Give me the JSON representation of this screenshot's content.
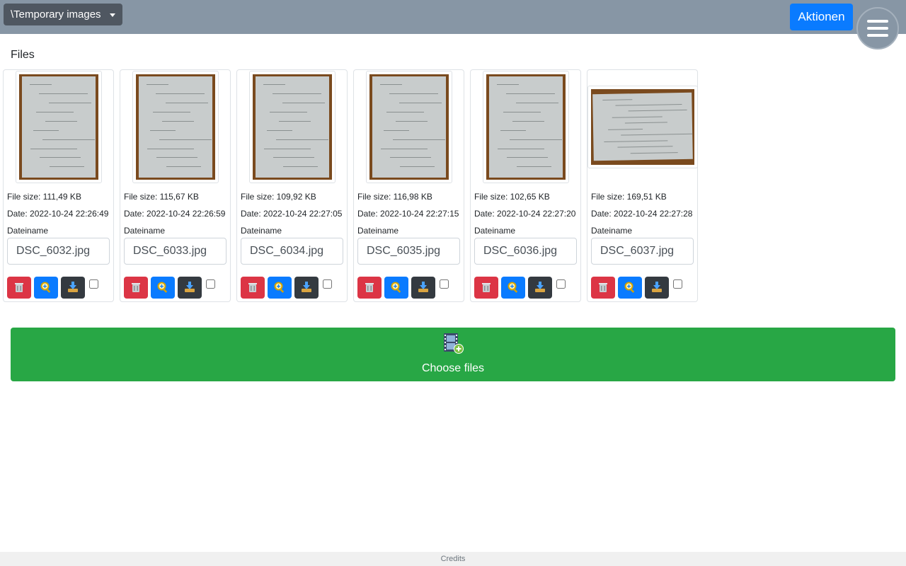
{
  "header": {
    "folder_label": "\\Temporary images",
    "actions_label": "Aktionen"
  },
  "section_title": "Files",
  "files": [
    {
      "size_text": "File size: 111,49 KB",
      "date_text": "Date: 2022-10-24 22:26:49",
      "name_label": "Dateiname",
      "filename": "DSC_6032.jpg",
      "orientation": "portrait"
    },
    {
      "size_text": "File size: 115,67 KB",
      "date_text": "Date: 2022-10-24 22:26:59",
      "name_label": "Dateiname",
      "filename": "DSC_6033.jpg",
      "orientation": "portrait"
    },
    {
      "size_text": "File size: 109,92 KB",
      "date_text": "Date: 2022-10-24 22:27:05",
      "name_label": "Dateiname",
      "filename": "DSC_6034.jpg",
      "orientation": "portrait"
    },
    {
      "size_text": "File size: 116,98 KB",
      "date_text": "Date: 2022-10-24 22:27:15",
      "name_label": "Dateiname",
      "filename": "DSC_6035.jpg",
      "orientation": "portrait"
    },
    {
      "size_text": "File size: 102,65 KB",
      "date_text": "Date: 2022-10-24 22:27:20",
      "name_label": "Dateiname",
      "filename": "DSC_6036.jpg",
      "orientation": "portrait"
    },
    {
      "size_text": "File size: 169,51 KB",
      "date_text": "Date: 2022-10-24 22:27:28",
      "name_label": "Dateiname",
      "filename": "DSC_6037.jpg",
      "orientation": "landscape"
    }
  ],
  "card_actions": {
    "delete_icon": "trash-icon",
    "view_icon": "magnify-icon",
    "download_icon": "download-icon"
  },
  "choose_files_label": "Choose files",
  "footer_label": "Credits",
  "colors": {
    "header_bg": "#8796a5",
    "primary": "#0a7bff",
    "danger": "#dc3545",
    "dark": "#343a40",
    "success": "#28a745"
  }
}
